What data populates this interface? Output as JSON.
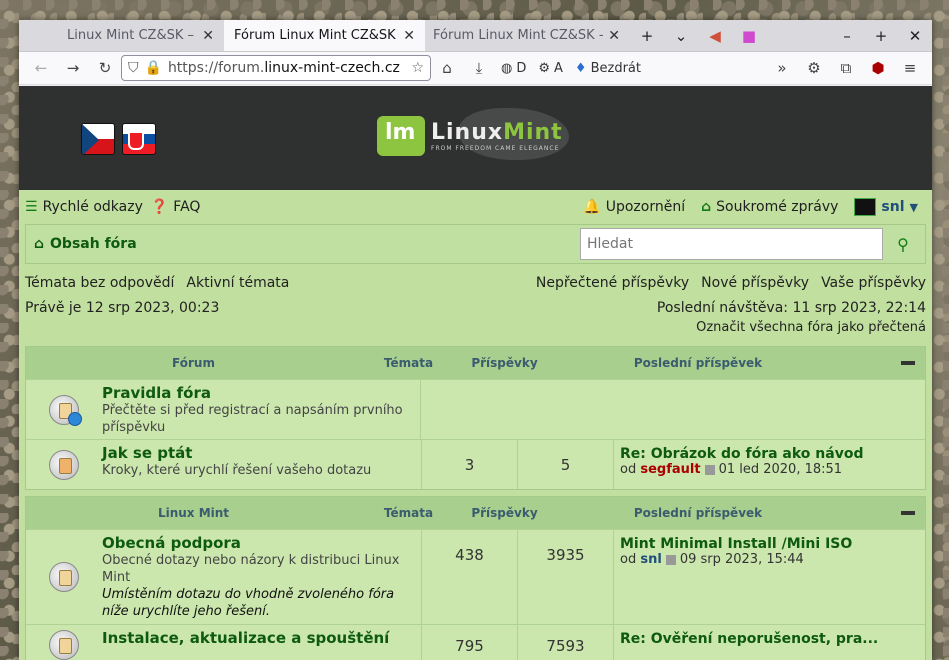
{
  "browser": {
    "tabs": [
      {
        "title": "Linux Mint CZ&SK – Komunit",
        "active": false
      },
      {
        "title": "Fórum Linux Mint CZ&SK - O",
        "active": true
      },
      {
        "title": "Fórum Linux Mint CZ&SK - O",
        "active": false
      }
    ],
    "url_prefix": "https://forum.",
    "url_domain": "linux-mint-czech.cz",
    "ext_d": "D",
    "ext_a": "A",
    "ext_bezdrat": "Bezdrát"
  },
  "site": {
    "logo_text_1": "Linux",
    "logo_text_2": "Mint",
    "logo_sub": "FROM FREEDOM CAME ELEGANCE"
  },
  "topnav": {
    "quick_links": "Rychlé odkazy",
    "faq": "FAQ",
    "notifications": "Upozornění",
    "messages": "Soukromé zprávy",
    "user": "snl"
  },
  "breadcrumb": {
    "home": "Obsah fóra"
  },
  "search": {
    "placeholder": "Hledat"
  },
  "links": {
    "unanswered": "Témata bez odpovědí",
    "active": "Aktivní témata",
    "unread": "Nepřečtené příspěvky",
    "new": "Nové příspěvky",
    "yours": "Vaše příspěvky"
  },
  "status": {
    "now": "Právě je 12 srp 2023, 00:23",
    "last_visit": "Poslední návštěva: 11 srp 2023, 22:14",
    "mark_all": "Označit všechna fóra jako přečtená"
  },
  "blocks": [
    {
      "header": {
        "name": "Fórum",
        "topics": "Témata",
        "posts": "Příspěvky",
        "last": "Poslední příspěvek"
      },
      "rows": [
        {
          "title": "Pravidla fóra",
          "desc": "Přečtěte si před registrací a napsáním prvního příspěvku",
          "topics": "",
          "posts": "",
          "last_title": "",
          "last_by": "",
          "last_user": "",
          "last_date": ""
        },
        {
          "title": "Jak se ptát",
          "desc": "Kroky, které urychlí řešení vašeho dotazu",
          "topics": "3",
          "posts": "5",
          "last_title": "Re: Obrázok do fóra ako návod",
          "last_by": "od",
          "last_user": "segfault",
          "last_date": "01 led 2020, 18:51"
        }
      ]
    },
    {
      "header": {
        "name": "Linux Mint",
        "topics": "Témata",
        "posts": "Příspěvky",
        "last": "Poslední příspěvek"
      },
      "rows": [
        {
          "title": "Obecná podpora",
          "desc": "Obecné dotazy nebo názory k distribuci Linux Mint",
          "note": "Umístěním dotazu do vhodně zvoleného fóra níže urychlíte jeho řešení.",
          "topics": "438",
          "posts": "3935",
          "last_title": "Mint Minimal Install /Mini ISO",
          "last_by": "od",
          "last_user": "snl",
          "last_date": "09 srp 2023, 15:44"
        },
        {
          "title": "Instalace, aktualizace a spouštění",
          "desc": "",
          "topics": "795",
          "posts": "7593",
          "last_title": "Re: Ověření neporušenost, pra...",
          "last_by": "",
          "last_user": "",
          "last_date": ""
        }
      ]
    }
  ]
}
